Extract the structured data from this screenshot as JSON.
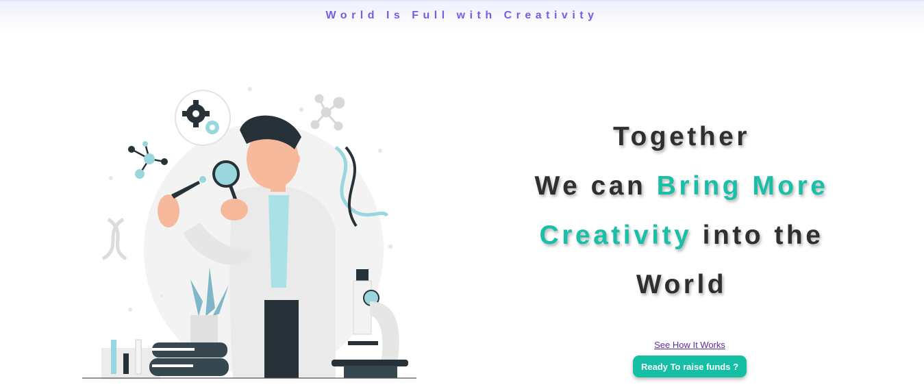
{
  "header": {
    "tagline": "World Is Full with Creativity"
  },
  "hero": {
    "line1": "Together",
    "line2_plain": "We can ",
    "line2_highlight": "Bring More",
    "line3_highlight": "Creativity",
    "line3_plain": " into the",
    "line4": "World",
    "link_label": "See How It Works",
    "cta_label": "Ready To raise funds ?"
  },
  "colors": {
    "accent": "#1bbfa7",
    "tagline": "#7b5ae6",
    "heading": "#2f2f2f",
    "link": "#5a2ca0"
  },
  "illustration": {
    "icon": "scientist-illustration"
  }
}
